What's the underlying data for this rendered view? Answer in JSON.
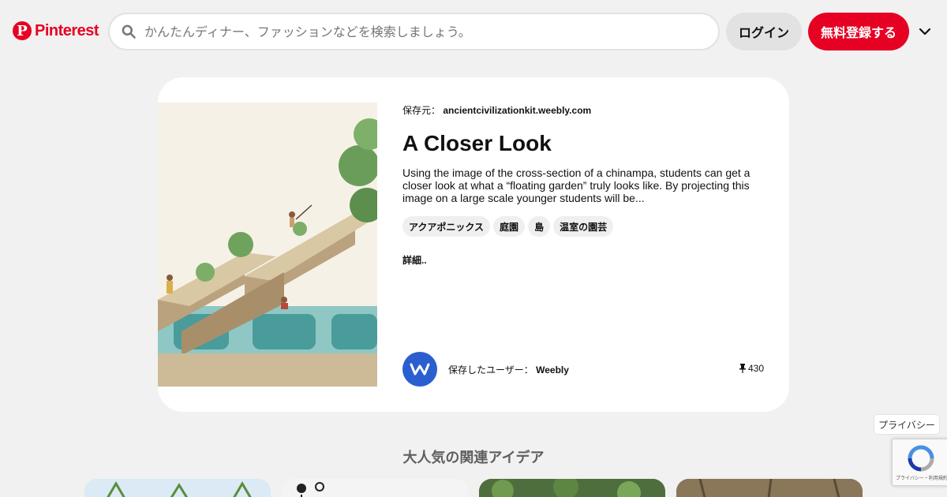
{
  "header": {
    "brand": "Pinterest",
    "search_placeholder": "かんたんディナー、ファッションなどを検索しましょう。",
    "login_label": "ログイン",
    "signup_label": "無料登録する",
    "brand_color": "#e60023"
  },
  "pin": {
    "source_prefix": "保存元：",
    "source_domain": "ancientcivilizationkit.weebly.com",
    "title": "A Closer Look",
    "description": "Using the image of the cross-section of a chinampa, students can get a closer look at what a “floating garden” truly looks like. By projecting this image on a large scale younger students will be...",
    "tags": [
      "アクアポニックス",
      "庭園",
      "島",
      "温室の園芸"
    ],
    "more_label": "詳細..",
    "saver_prefix": "保存したユーザー：",
    "saver_name": "Weebly",
    "save_count": "430"
  },
  "related": {
    "heading": "大人気の関連アイデア"
  },
  "footer": {
    "privacy_label": "プライバシー",
    "recaptcha_small": "プライバシー・利用規約"
  }
}
